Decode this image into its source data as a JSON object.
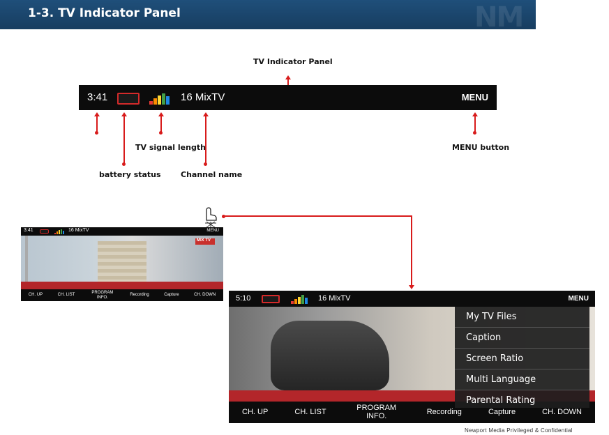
{
  "header": {
    "title": "1-3. TV Indicator Panel",
    "logo": "NM"
  },
  "panel": {
    "time": "3:41",
    "channel": "16 MixTV",
    "menu": "MENU"
  },
  "callouts": {
    "panel": "TV Indicator Panel",
    "signal": "TV signal length",
    "menu_button": "MENU button",
    "battery": "battery status",
    "channel_name": "Channel name"
  },
  "small_screen": {
    "time": "3:41",
    "channel": "16 MixTV",
    "menu": "MENU",
    "channel_logo": "MIX TV",
    "controls": [
      "CH. UP",
      "CH. LIST",
      "PROGRAM INFO.",
      "Recording",
      "Capture",
      "CH. DOWN"
    ]
  },
  "large_screen": {
    "time": "5:10",
    "channel": "16 MixTV",
    "menu": "MENU",
    "controls": [
      "CH. UP",
      "CH. LIST",
      "PROGRAM INFO.",
      "Recording",
      "Capture",
      "CH. DOWN"
    ],
    "menu_items": [
      "My TV Files",
      "Caption",
      "Screen Ratio",
      "Multi Language",
      "Parental Rating"
    ]
  },
  "footer": "Newport Media Privileged & Confidential",
  "colors": {
    "header_bg": "#1f4f7a",
    "arrow": "#d81b1b",
    "bar_bg": "#0c0c0c"
  }
}
